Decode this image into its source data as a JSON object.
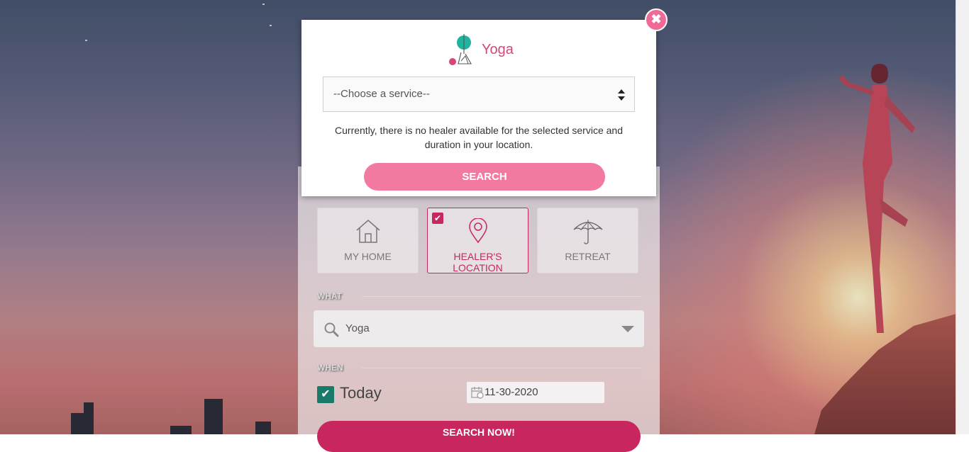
{
  "modal": {
    "title": "Yoga",
    "service_select": {
      "value": "--Choose a service--"
    },
    "message": "Currently, there is no healer available for the selected service and duration in your location.",
    "search_label": "SEARCH",
    "close_icon": "close-icon",
    "accent": "#f27aa1"
  },
  "panel": {
    "locations": [
      {
        "label": "MY HOME",
        "icon": "home-icon",
        "selected": false
      },
      {
        "label": "HEALER'S LOCATION",
        "icon": "map-pin-icon",
        "selected": true
      },
      {
        "label": "RETREAT",
        "icon": "umbrella-icon",
        "selected": false
      }
    ],
    "what_label": "WHAT",
    "what_value": "Yoga",
    "when_label": "WHEN",
    "today_label": "Today",
    "today_checked": true,
    "date_value": "11-30-2020",
    "search_now_label": "SEARCH NOW!",
    "accent": "#c8265e"
  }
}
